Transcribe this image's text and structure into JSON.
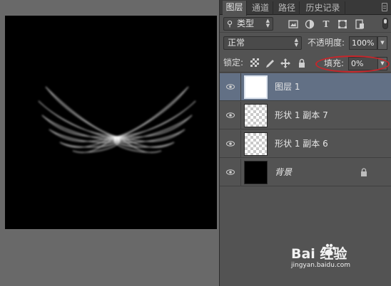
{
  "tabs": [
    {
      "label": "图层",
      "active": true
    },
    {
      "label": "通道",
      "active": false
    },
    {
      "label": "路径",
      "active": false
    },
    {
      "label": "历史记录",
      "active": false
    }
  ],
  "filter": {
    "kind_label": "类型",
    "icons": [
      "image-filter-icon",
      "adjustment-filter-icon",
      "text-filter-icon",
      "shape-filter-icon",
      "smart-object-filter-icon"
    ]
  },
  "blend": {
    "mode": "正常",
    "opacity_label": "不透明度:",
    "opacity_value": "100%"
  },
  "lock": {
    "label": "锁定:",
    "icons": [
      "lock-transparent-icon",
      "lock-image-icon",
      "lock-position-icon",
      "lock-all-icon"
    ],
    "fill_label": "填充:",
    "fill_value": "0%"
  },
  "layers": [
    {
      "name": "图层 1",
      "thumb": "white",
      "selected": true,
      "visible": true,
      "locked": false
    },
    {
      "name": "形状 1 副本 7",
      "thumb": "checker",
      "selected": false,
      "visible": true,
      "locked": false
    },
    {
      "name": "形状 1 副本 6",
      "thumb": "checker",
      "selected": false,
      "visible": true,
      "locked": false
    },
    {
      "name": "背景",
      "thumb": "black",
      "selected": false,
      "visible": true,
      "locked": true
    }
  ],
  "watermark": {
    "brand": "Bai 经验",
    "url": "jingyan.baidu.com"
  },
  "colors": {
    "panel_bg": "#535353",
    "selected_layer": "#627085",
    "highlight_circle": "#c8262b",
    "canvas": "#000000"
  }
}
